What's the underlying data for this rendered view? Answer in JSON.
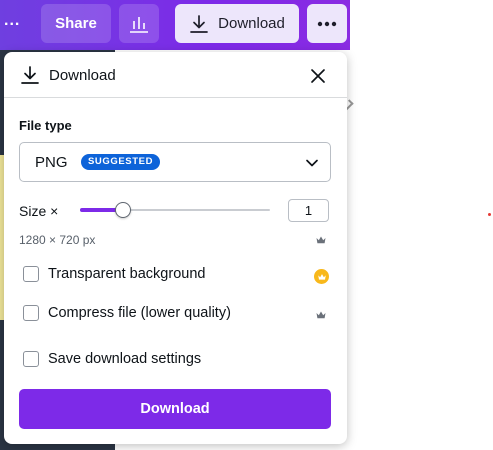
{
  "toolbar": {
    "ellipsis": "...",
    "share_label": "Share",
    "download_label": "Download",
    "insights_icon": "bar-chart-icon",
    "more_icon": "more-horizontal-icon"
  },
  "panel": {
    "title": "Download",
    "header_icon": "download-icon",
    "close_icon": "close-icon",
    "file_type": {
      "label": "File type",
      "selected": "PNG",
      "badge": "SUGGESTED"
    },
    "size": {
      "label": "Size ×",
      "value": "1",
      "slider_fraction": 0.2,
      "dimensions": "1280 × 720 px"
    },
    "options": [
      {
        "label": "Transparent background",
        "checked": false,
        "premium_badge": "crown-gold-icon"
      },
      {
        "label": "Compress file (lower quality)",
        "checked": false,
        "premium_badge": "crown-icon"
      },
      {
        "label": "Save download settings",
        "checked": false
      }
    ],
    "download_button": "Download"
  },
  "colors": {
    "accent": "#7d2ae8",
    "badge_blue": "#0d63d9",
    "crown_gold": "#f8b81b"
  }
}
